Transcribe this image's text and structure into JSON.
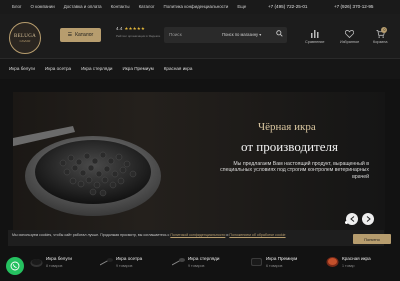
{
  "topbar": {
    "nav": [
      "Блог",
      "О компании",
      "Доставка и оплата",
      "Контакты",
      "Каталог",
      "Политика конфиденциальности",
      "Еще"
    ],
    "phone1": "+7 (495) 722-25-01",
    "phone2": "+7 (926) 370-12-95",
    "phone_caption": "Ежедневно с 9:00 до 21:00"
  },
  "logo": {
    "line1": "BELUGA",
    "line2": "CAVIAR"
  },
  "header": {
    "catalog_label": "Каталог",
    "rating_value": "4.4",
    "rating_stars": "★★★★★",
    "rating_caption": "Рейтинг организации в Яндексе",
    "search_placeholder": "Поиск",
    "search_scope": "Поиск по магазину",
    "compare_label": "Сравнение",
    "favorites_label": "Избранное",
    "cart_label": "Корзина",
    "cart_count": "0"
  },
  "menu": {
    "items": [
      "Икра белуги",
      "Икра осетра",
      "Икра стерляди",
      "Икра Премиум",
      "Красная икра"
    ]
  },
  "hero": {
    "title_line1": "Чёрная икра",
    "title_line2": "от производителя",
    "description": "Мы предлагаем Вам настоящий продукт, выращенный в специальных условиях под строгим контролем ветеринарных врачей"
  },
  "cookie": {
    "text": "Мы используем cookies, чтобы сайт работал лучше. Продолжая просмотр, вы соглашаетесь с",
    "link1": "Политикой конфиденциальности",
    "link_join": "и",
    "link2": "Положением об обработке cookie",
    "button": "Понятно"
  },
  "categories": [
    {
      "name": "Икра белуги",
      "count": "8 товаров"
    },
    {
      "name": "Икра осетра",
      "count": "9 товаров"
    },
    {
      "name": "Икра стерляди",
      "count": "9 товаров"
    },
    {
      "name": "Икра Премиум",
      "count": "6 товаров"
    },
    {
      "name": "Красная икра",
      "count": "1 товар"
    }
  ],
  "colors": {
    "accent": "#b79d6e",
    "background": "#121212",
    "whatsapp": "#25c160"
  }
}
